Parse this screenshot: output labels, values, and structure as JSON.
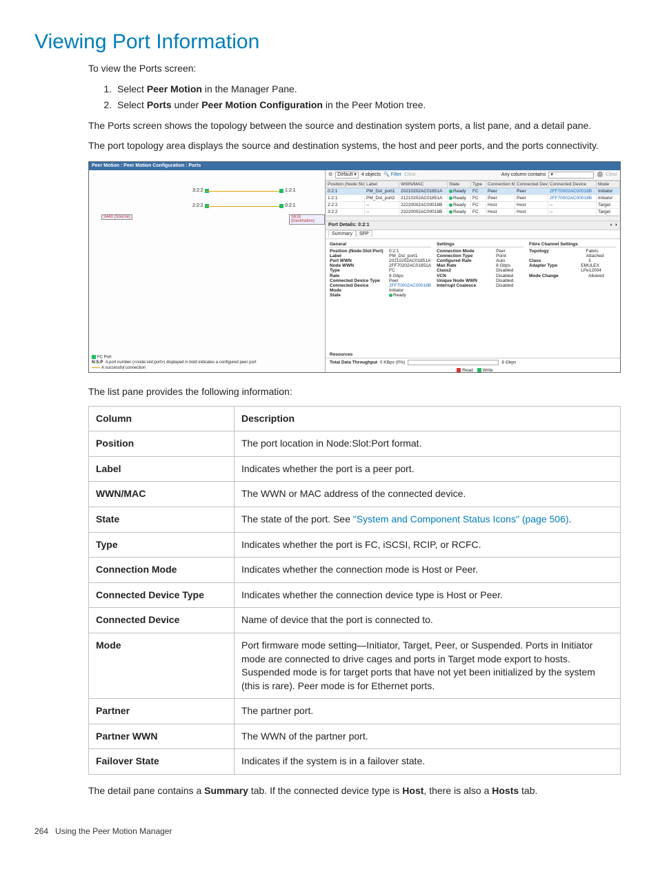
{
  "heading": "Viewing Port Information",
  "intro": "To view the Ports screen:",
  "steps": [
    {
      "pre": "Select ",
      "bold": "Peer Motion",
      "post": " in the Manager Pane."
    },
    {
      "pre": "Select ",
      "bold": "Ports",
      "mid": " under ",
      "bold2": "Peer Motion Configuration",
      "post": " in the Peer Motion tree."
    }
  ],
  "para1": "The Ports screen shows the topology between the source and destination system ports, a list pane, and a detail pane.",
  "para2": "The port topology area displays the source and destination systems, the host and peer ports, and the ports connectivity.",
  "screenshot": {
    "titlebar": "Peer Motion : Peer Motion Configuration : Ports",
    "toolbar": {
      "default": "Default",
      "objects": "4 objects",
      "filter": "Filter",
      "clear": "Clear",
      "anycol": "Any column contains",
      "printClear": "Clear"
    },
    "columns": [
      "Position (Node:Slot:Port)",
      "Label",
      "WWN/MAC",
      "State",
      "Type",
      "Connection Mode",
      "Connected Device Type",
      "Connected Device",
      "Mode"
    ],
    "rows": [
      {
        "pos": "0:2:1",
        "label": "PM_Dst_port1",
        "wwn": "20210202AC01851A",
        "state": "Ready",
        "type": "FC",
        "cm": "Peer",
        "cdt": "Peer",
        "cd": "2FF70002AC00018B",
        "mode": "Initiator",
        "sel": true
      },
      {
        "pos": "1:2:1",
        "label": "PM_Dst_port2",
        "wwn": "21210202AC01851A",
        "state": "Ready",
        "type": "FC",
        "cm": "Peer",
        "cdt": "Peer",
        "cd": "2FF70002AC00018B",
        "mode": "Initiator"
      },
      {
        "pos": "2:2:2",
        "label": "--",
        "wwn": "22220002AC00018B",
        "state": "Ready",
        "type": "FC",
        "cm": "Host",
        "cdt": "Host",
        "cd": "--",
        "mode": "Target"
      },
      {
        "pos": "3:2:2",
        "label": "--",
        "wwn": "23220002AC00018B",
        "state": "Ready",
        "type": "FC",
        "cm": "Host",
        "cdt": "Host",
        "cd": "--",
        "mode": "Target"
      }
    ],
    "topo": {
      "p1l": "3:2:2",
      "p1r": "1:2:1",
      "p2l": "2:2:2",
      "p2r": "0:2:1",
      "sysl": "S440 (Source)",
      "sysr": "S618 (Destination)"
    },
    "legend": {
      "l1": "FC Port",
      "l2pre": "N:S:P",
      "l2": "A port number (<node:slot:port>) displayed in bold indicates a configured peer port",
      "l3": "A successful connection"
    },
    "detailTitle": "Port Details: 0:2:1",
    "tabs": {
      "summary": "Summary",
      "sfp": "SFP"
    },
    "general": {
      "title": "General",
      "items": [
        {
          "k": "Position (Node:Slot:Port)",
          "v": "0:2:1"
        },
        {
          "k": "Label",
          "v": "PM_Dst_port1"
        },
        {
          "k": "Port WWN",
          "v": "20210202AC01851A"
        },
        {
          "k": "Node WWN",
          "v": "2FF70202AC01851A"
        },
        {
          "k": "Type",
          "v": "FC"
        },
        {
          "k": "Rate",
          "v": "8 Gbps"
        },
        {
          "k": "Connected Device Type",
          "v": "Peer"
        },
        {
          "k": "Connected Device",
          "v": "2FF70002AC00018B"
        },
        {
          "k": "Mode",
          "v": "Initiator"
        },
        {
          "k": "State",
          "v": "Ready"
        }
      ]
    },
    "settings": {
      "title": "Settings",
      "items": [
        {
          "k": "Connection Mode",
          "v": "Peer"
        },
        {
          "k": "Connection Type",
          "v": "Point"
        },
        {
          "k": "Configured Rate",
          "v": "Auto"
        },
        {
          "k": "Max Rate",
          "v": "8 Gbps"
        },
        {
          "k": "Class2",
          "v": "Disabled"
        },
        {
          "k": "VCN",
          "v": "Disabled"
        },
        {
          "k": "Unique Node WWN",
          "v": "Disabled"
        },
        {
          "k": "Interrupt Coalesce",
          "v": "Disabled"
        }
      ]
    },
    "fcs": {
      "title": "Fibre Channel Settings",
      "items": [
        {
          "k": "Topology",
          "v": "Fabric Attached"
        },
        {
          "k": "Class",
          "v": "3"
        },
        {
          "k": "Adapter Type",
          "v": "EMULEX LPe12004"
        },
        {
          "k": "Mode Change",
          "v": "Allowed"
        }
      ]
    },
    "resources": "Resources",
    "throughput": {
      "label": "Total Data Throughput",
      "val": "0 KBps (0%)",
      "max": "8 Gbps"
    },
    "rw": {
      "read": "Read",
      "write": "Write"
    }
  },
  "listIntro": "The list pane provides the following information:",
  "table": {
    "head": [
      "Column",
      "Description"
    ],
    "rows": [
      {
        "c": "Position",
        "d": "The port location in Node:Slot:Port format."
      },
      {
        "c": "Label",
        "d": "Indicates whether the port is a peer port."
      },
      {
        "c": "WWN/MAC",
        "d": "The WWN or MAC address of the connected device."
      },
      {
        "c": "State",
        "d_pre": "The state of the port. See ",
        "link": "\"System and Component Status Icons\" (page 506)",
        "d_post": "."
      },
      {
        "c": "Type",
        "d": "Indicates whether the port is FC, iSCSI, RCIP, or RCFC."
      },
      {
        "c": "Connection Mode",
        "d": "Indicates whether the connection mode is Host or Peer."
      },
      {
        "c": "Connected Device Type",
        "d": "Indicates whether the connection device type is Host or Peer."
      },
      {
        "c": "Connected Device",
        "d": "Name of device that the port is connected to."
      },
      {
        "c": "Mode",
        "d": "Port firmware mode setting—Initiator, Target, Peer, or Suspended. Ports in Initiator mode are connected to drive cages and ports in Target mode export to hosts. Suspended mode is for target ports that have not yet been initialized by the system (this is rare). Peer mode is for Ethernet ports."
      },
      {
        "c": "Partner",
        "d": "The partner port."
      },
      {
        "c": "Partner WWN",
        "d": "The WWN of the partner port."
      },
      {
        "c": "Failover State",
        "d": "Indicates if the system is in a failover state."
      }
    ]
  },
  "outro": {
    "pre": "The detail pane contains a ",
    "b1": "Summary",
    "mid": " tab. If the connected device type is ",
    "b2": "Host",
    "mid2": ", there is also a ",
    "b3": "Hosts",
    "post": " tab."
  },
  "footer": {
    "page": "264",
    "text": "Using the Peer Motion Manager"
  }
}
